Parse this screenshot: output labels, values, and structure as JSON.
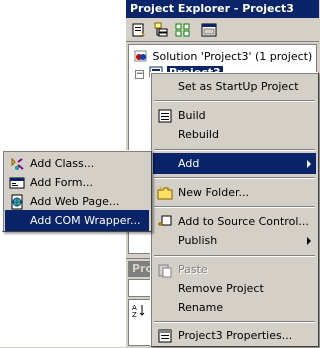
{
  "window": {
    "title": "Project Explorer - Project3"
  },
  "toolbar": {
    "buttons": [
      "properties-icon",
      "show-all-files-icon",
      "refresh-icon",
      "view-designer-icon"
    ]
  },
  "tree": {
    "solution_label": "Solution 'Project3' (1 project)",
    "project_label": "Project3"
  },
  "props": {
    "title_fragment": "Pro"
  },
  "context_menu": {
    "items": [
      {
        "label": "Set as StartUp Project",
        "icon": ""
      },
      {
        "label": "Build",
        "icon": "build-icon"
      },
      {
        "label": "Rebuild",
        "icon": ""
      },
      {
        "label": "Add",
        "icon": "",
        "submenu": true,
        "highlighted": true
      },
      {
        "label": "New Folder...",
        "icon": "new-folder-icon"
      },
      {
        "label": "Add to Source Control...",
        "icon": "source-control-icon"
      },
      {
        "label": "Publish",
        "icon": "",
        "submenu": true
      },
      {
        "label": "Paste",
        "icon": "paste-icon",
        "disabled": true
      },
      {
        "label": "Remove Project",
        "icon": ""
      },
      {
        "label": "Rename",
        "icon": ""
      },
      {
        "label": "Project3 Properties...",
        "icon": "properties-icon"
      }
    ]
  },
  "add_submenu": {
    "items": [
      {
        "label": "Add Class...",
        "icon": "class-icon"
      },
      {
        "label": "Add Form...",
        "icon": "form-icon"
      },
      {
        "label": "Add Web Page...",
        "icon": "web-page-icon"
      },
      {
        "label": "Add COM Wrapper...",
        "icon": "",
        "highlighted": true
      }
    ]
  },
  "colors": {
    "highlight": "#0a246a",
    "face": "#d4d0c8"
  }
}
